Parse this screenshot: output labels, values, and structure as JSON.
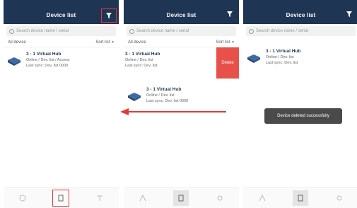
{
  "screens": [
    {
      "title": "Device list",
      "search_placeholder": "Search device name / serial",
      "sort_left": "All device",
      "sort_right": "Sort list",
      "devices": [
        {
          "name": "3 - 1 Virtual Hub",
          "line1": "Online / Dev. list / Access",
          "line2": "Last sync: Dev. list 0000"
        }
      ]
    },
    {
      "title": "Device list",
      "search_placeholder": "Search device name / serial",
      "sort_left": "All device",
      "sort_right": "Sort list",
      "devices": [
        {
          "name": "3 - 1 Virtual Hub",
          "line1": "Online / Dev. list",
          "line2": "Last sync: Dev. list"
        },
        {
          "name": "3 - 1 Virtual Hub",
          "line1": "Online / Dev. list",
          "line2": "Last sync: Dev. list 0000"
        }
      ],
      "delete_label": "Delete"
    },
    {
      "title": "Device list",
      "search_placeholder": "Search device name / serial",
      "devices": [
        {
          "name": "3 - 1 Virtual Hub",
          "line1": "Online / Dev. list",
          "line2": "Last sync: Dev. list"
        }
      ],
      "toast": "Device deleted successfully"
    }
  ],
  "colors": {
    "navbar": "#1f3554",
    "delete": "#e8504a",
    "highlight": "#e53935",
    "arrow": "#e53935"
  },
  "icons": {
    "filter": "filter-icon",
    "device": "router-icon",
    "tab_left": "home-icon",
    "tab_mid": "device-icon",
    "tab_right": "settings-icon"
  }
}
